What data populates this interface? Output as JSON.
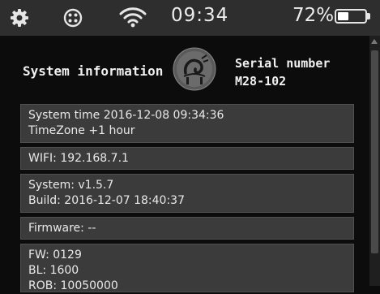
{
  "status_bar": {
    "time": "09:34",
    "battery_percent_label": "72%",
    "battery_level": 0.42,
    "icons": [
      "gear-icon",
      "reels-icon",
      "wifi-icon",
      "battery-icon"
    ]
  },
  "header": {
    "title": "System information",
    "serial_label": "Serial number",
    "serial_value": "M28-102",
    "logo": "fossilnab-logo"
  },
  "panels": {
    "time": {
      "line1": "System time 2016-12-08 09:34:36",
      "line2": "TimeZone +1 hour"
    },
    "wifi": {
      "line1": "WIFI: 192.168.7.1"
    },
    "system": {
      "line1": "System: v1.5.7",
      "line2": "Build: 2016-12-07 18:40:37"
    },
    "firmware": {
      "line1": "Firmware: --"
    },
    "fw": {
      "line1": "FW: 0129",
      "line2": "BL: 1600",
      "line3": "ROB: 10050000"
    }
  },
  "colors": {
    "background": "#0c0c0c",
    "status_bar": "#2e2e2e",
    "panel": "#3b3b3b",
    "text": "#e9e9e9"
  }
}
